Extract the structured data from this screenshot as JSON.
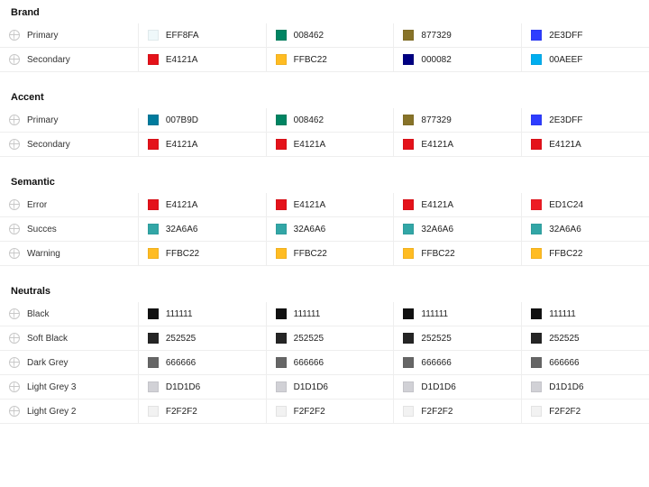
{
  "sections": [
    {
      "title": "Brand",
      "rows": [
        {
          "label": "Primary",
          "cells": [
            {
              "hex": "EFF8FA",
              "c": "#EFF8FA"
            },
            {
              "hex": "008462",
              "c": "#008462"
            },
            {
              "hex": "877329",
              "c": "#877329"
            },
            {
              "hex": "2E3DFF",
              "c": "#2E3DFF"
            }
          ]
        },
        {
          "label": "Secondary",
          "cells": [
            {
              "hex": "E4121A",
              "c": "#E4121A"
            },
            {
              "hex": "FFBC22",
              "c": "#FFBC22"
            },
            {
              "hex": "000082",
              "c": "#000082"
            },
            {
              "hex": "00AEEF",
              "c": "#00AEEF"
            }
          ]
        }
      ]
    },
    {
      "title": "Accent",
      "rows": [
        {
          "label": "Primary",
          "cells": [
            {
              "hex": "007B9D",
              "c": "#007B9D"
            },
            {
              "hex": "008462",
              "c": "#008462"
            },
            {
              "hex": "877329",
              "c": "#877329"
            },
            {
              "hex": "2E3DFF",
              "c": "#2E3DFF"
            }
          ]
        },
        {
          "label": "Secondary",
          "cells": [
            {
              "hex": "E4121A",
              "c": "#E4121A"
            },
            {
              "hex": "E4121A",
              "c": "#E4121A"
            },
            {
              "hex": "E4121A",
              "c": "#E4121A"
            },
            {
              "hex": "E4121A",
              "c": "#E4121A"
            }
          ]
        }
      ]
    },
    {
      "title": "Semantic",
      "rows": [
        {
          "label": "Error",
          "cells": [
            {
              "hex": "E4121A",
              "c": "#E4121A"
            },
            {
              "hex": "E4121A",
              "c": "#E4121A"
            },
            {
              "hex": "E4121A",
              "c": "#E4121A"
            },
            {
              "hex": "ED1C24",
              "c": "#ED1C24"
            }
          ]
        },
        {
          "label": "Succes",
          "cells": [
            {
              "hex": "32A6A6",
              "c": "#32A6A6"
            },
            {
              "hex": "32A6A6",
              "c": "#32A6A6"
            },
            {
              "hex": "32A6A6",
              "c": "#32A6A6"
            },
            {
              "hex": "32A6A6",
              "c": "#32A6A6"
            }
          ]
        },
        {
          "label": "Warning",
          "cells": [
            {
              "hex": "FFBC22",
              "c": "#FFBC22"
            },
            {
              "hex": "FFBC22",
              "c": "#FFBC22"
            },
            {
              "hex": "FFBC22",
              "c": "#FFBC22"
            },
            {
              "hex": "FFBC22",
              "c": "#FFBC22"
            }
          ]
        }
      ]
    },
    {
      "title": "Neutrals",
      "rows": [
        {
          "label": "Black",
          "cells": [
            {
              "hex": "111111",
              "c": "#111111"
            },
            {
              "hex": "111111",
              "c": "#111111"
            },
            {
              "hex": "111111",
              "c": "#111111"
            },
            {
              "hex": "111111",
              "c": "#111111"
            }
          ]
        },
        {
          "label": "Soft Black",
          "cells": [
            {
              "hex": "252525",
              "c": "#252525"
            },
            {
              "hex": "252525",
              "c": "#252525"
            },
            {
              "hex": "252525",
              "c": "#252525"
            },
            {
              "hex": "252525",
              "c": "#252525"
            }
          ]
        },
        {
          "label": "Dark Grey",
          "cells": [
            {
              "hex": "666666",
              "c": "#666666"
            },
            {
              "hex": "666666",
              "c": "#666666"
            },
            {
              "hex": "666666",
              "c": "#666666"
            },
            {
              "hex": "666666",
              "c": "#666666"
            }
          ]
        },
        {
          "label": "Light Grey 3",
          "cells": [
            {
              "hex": "D1D1D6",
              "c": "#D1D1D6"
            },
            {
              "hex": "D1D1D6",
              "c": "#D1D1D6"
            },
            {
              "hex": "D1D1D6",
              "c": "#D1D1D6"
            },
            {
              "hex": "D1D1D6",
              "c": "#D1D1D6"
            }
          ]
        },
        {
          "label": "Light Grey 2",
          "cells": [
            {
              "hex": "F2F2F2",
              "c": "#F2F2F2"
            },
            {
              "hex": "F2F2F2",
              "c": "#F2F2F2"
            },
            {
              "hex": "F2F2F2",
              "c": "#F2F2F2"
            },
            {
              "hex": "F2F2F2",
              "c": "#F2F2F2"
            }
          ]
        }
      ]
    }
  ]
}
